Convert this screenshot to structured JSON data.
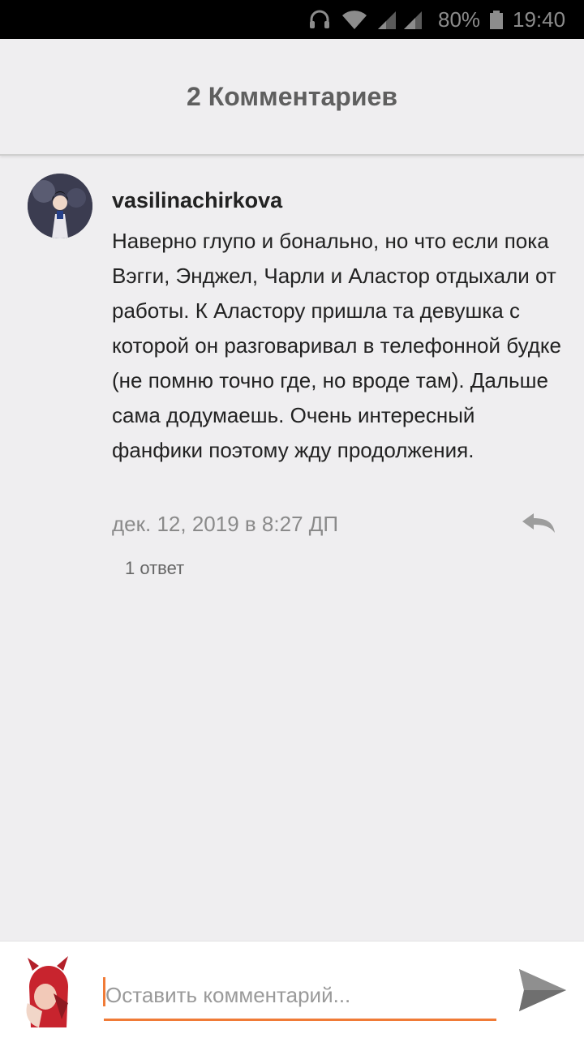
{
  "status_bar": {
    "battery": "80%",
    "time": "19:40",
    "icons": [
      "headphones-icon",
      "wifi-icon",
      "signal-icon",
      "signal-icon",
      "battery-icon"
    ]
  },
  "header": {
    "title": "2 Комментариев"
  },
  "comment": {
    "username": "vasilinachirkova",
    "body": "Наверно глупо и бонально, но что если пока Вэгги, Энджел, Чарли и Аластор отдыхали от работы. К Аластору пришла та девушка с которой он разговаривал в телефонной будке (не помню точно где, но вроде там). Дальше сама додумаешь. Очень интересный фанфики поэтому жду продолжения.",
    "date": "дек. 12, 2019 в 8:27 ДП",
    "replies": "1 ответ",
    "reply_icon": "reply-icon"
  },
  "compose": {
    "placeholder": "Оставить комментарий...",
    "value": "",
    "send_icon": "send-icon"
  },
  "colors": {
    "accent": "#f07b37",
    "background": "#efeef0",
    "header_text": "#5f5f5f",
    "status_bar": "#000000"
  }
}
